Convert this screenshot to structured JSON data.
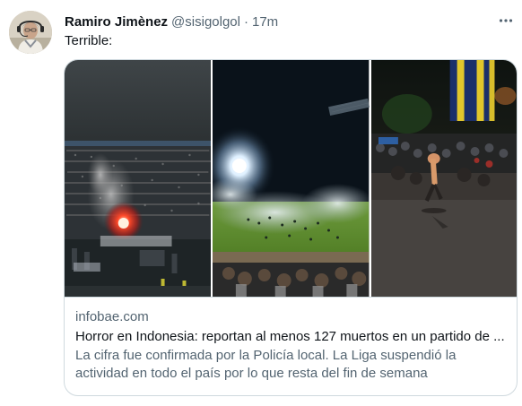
{
  "tweet": {
    "author_name": "Ramiro Jimènez",
    "author_handle": "@sisigolgol",
    "separator": "·",
    "timestamp": "17m",
    "text": "Terrible:",
    "more_icon": "ellipsis-icon"
  },
  "card": {
    "domain": "infobae.com",
    "title": "Horror en Indonesia: reportan al menos 127 muertos en un partido de ...",
    "description": "La cifra fue confirmada por la Policía local. La Liga suspendió la actividad en todo el país por lo que resta del fin de semana",
    "photos": [
      "stadium-crowd-flare-photo",
      "stadium-tear-gas-photo",
      "stadium-pitch-chaos-photo"
    ]
  },
  "colors": {
    "text_primary": "#0f1419",
    "text_secondary": "#536471",
    "border": "#cfd9de"
  }
}
